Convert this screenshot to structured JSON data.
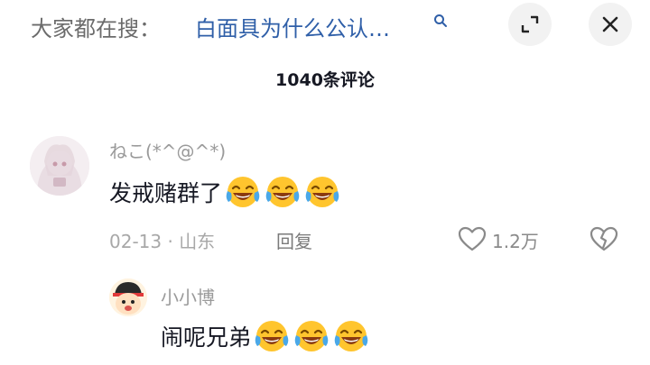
{
  "header": {
    "search_prefix": "大家都在搜：",
    "search_query": "白面具为什么公认…"
  },
  "comments_section": {
    "count_label": "1040条评论"
  },
  "comment": {
    "username": "ねこ(*^@^*)",
    "text": "发戒赌群了",
    "emoji_name": "laugh-cry",
    "date_location": "02-13 · 山东",
    "reply_label": "回复",
    "like_count": "1.2万"
  },
  "reply": {
    "username": "小小博",
    "text": "闹呢兄弟",
    "emoji_name": "laugh-cry"
  },
  "colors": {
    "link": "#2f5fa8",
    "muted": "#9a9a9a",
    "emoji_yellow": "#ffc52e"
  }
}
